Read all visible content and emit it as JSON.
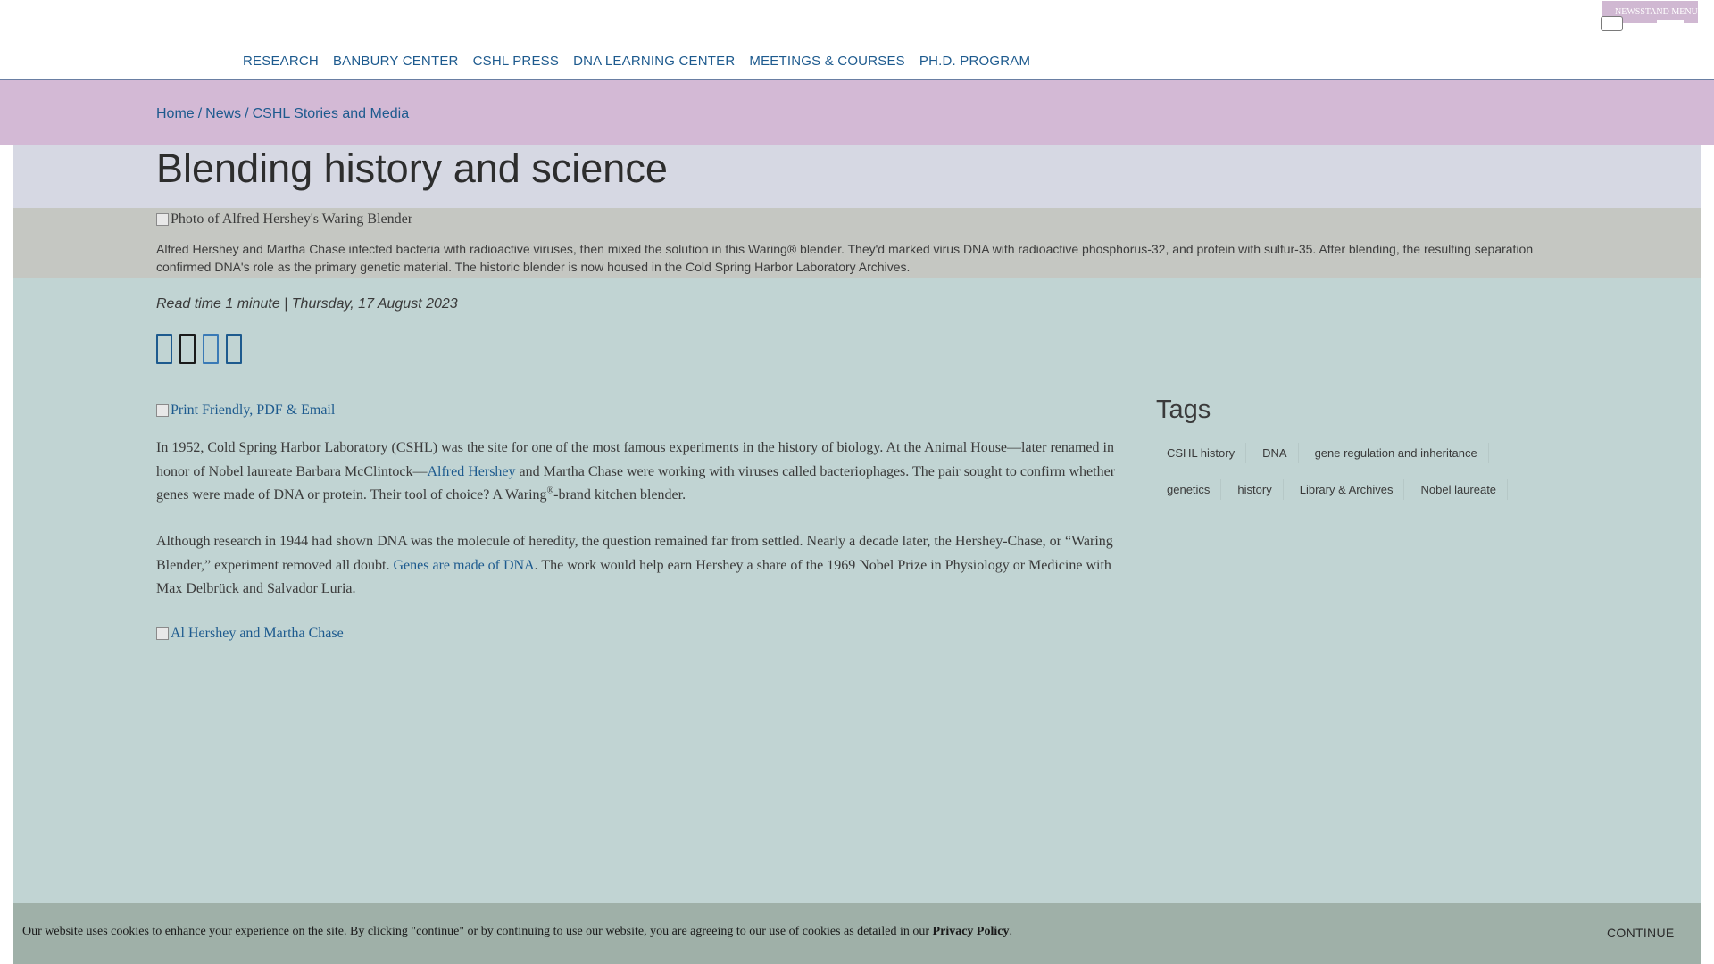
{
  "header": {
    "nav": [
      "RESEARCH",
      "BANBURY CENTER",
      "CSHL PRESS",
      "DNA LEARNING CENTER",
      "MEETINGS & COURSES",
      "PH.D. PROGRAM"
    ],
    "newsstand_menu_label": "NEWSSTAND MENU"
  },
  "breadcrumb": {
    "home": "Home",
    "sep": "/",
    "news": "News",
    "current": "CSHL Stories and Media"
  },
  "article": {
    "title": "Blending history and science",
    "hero_alt": "Photo of Alfred Hershey's Waring Blender",
    "hero_caption": "Alfred Hershey and Martha Chase infected bacteria with radioactive viruses, then mixed the solution in this Waring® blender. They'd marked virus DNA with radioactive phosphorus-32, and protein with sulfur-35. After blending, the resulting separation confirmed DNA's role as the primary genetic material. The historic blender is now housed in the Cold Spring Harbor Laboratory Archives.",
    "meta": "Read time 1 minute | Thursday, 17 August 2023",
    "share_icons": [
      "facebook-icon",
      "x-twitter-icon",
      "linkedin-icon",
      "email-icon"
    ],
    "print_link": "Print Friendly, PDF & Email",
    "para1": {
      "before_link": "In 1952, Cold Spring Harbor Laboratory (CSHL) was the site for one of the most famous experiments in the history of biology. At the Animal House—later renamed in honor of Nobel laureate Barbara McClintock—",
      "link": "Alfred Hershey",
      "after_link": " and Martha Chase were working with viruses called bacteriophages. The pair sought to confirm whether genes were made of DNA or protein. Their tool of choice? A Waring",
      "sup": "®",
      "end": "-brand kitchen blender."
    },
    "para2": {
      "before_link": "Although research in 1944 had shown DNA was the molecule of heredity, the question remained far from settled. Nearly a decade later, the Hershey-Chase, or “Waring Blender,” experiment removed all doubt. ",
      "link": "Genes are made of DNA",
      "after_link": ". The work would help earn Hershey a share of the 1969 Nobel Prize in Physiology or Medicine with Max Delbrück and Salvador Luria."
    },
    "photo_alt": "Al Hershey and Martha Chase"
  },
  "tags": {
    "heading": "Tags",
    "items": [
      "CSHL history",
      "DNA",
      "gene regulation and inheritance",
      "genetics",
      "history",
      "Library & Archives",
      "Nobel laureate"
    ]
  },
  "cookie": {
    "text": "Our website uses cookies to enhance your experience on the site. By clicking \"continue\" or by continuing to use our website, you are agreeing to our use of cookies as detailed in our ",
    "policy_link": "Privacy Policy",
    "end": ".",
    "continue": "CONTINUE"
  },
  "colors": {
    "link": "#1d5a8e",
    "breadcrumb_band": "#d3b9d5",
    "content_bg": "#c1d4d3",
    "cookie_bar": "#9fb0a8"
  }
}
